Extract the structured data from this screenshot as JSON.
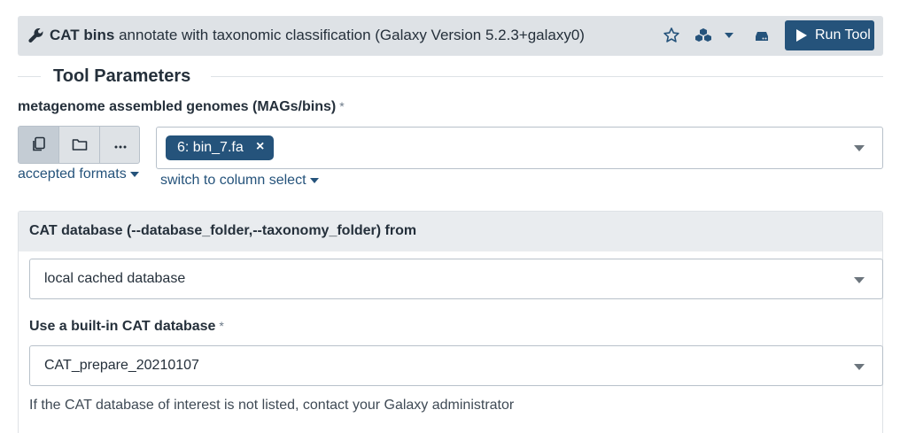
{
  "header": {
    "tool_name": "CAT bins",
    "description": "annotate with taxonomic classification (Galaxy Version 5.2.3+galaxy0)",
    "icons": [
      "wrench-icon",
      "star-icon",
      "cubes-icon",
      "caret-down-icon",
      "hdd-icon"
    ],
    "run_label": "Run Tool"
  },
  "section": {
    "title": "Tool Parameters"
  },
  "input_mags": {
    "label": "metagenome assembled genomes (MAGs/bins)",
    "required_mark": "*",
    "source_buttons": [
      "copy-icon",
      "folder-icon",
      "ellipsis-icon"
    ],
    "selected_chip": "6: bin_7.fa",
    "chip_remove": "×",
    "accepted_formats_label": "accepted formats",
    "switch_label": "switch to column select"
  },
  "db_panel": {
    "title": "CAT database (--database_folder,--taxonomy_folder) from",
    "source_value": "local cached database",
    "builtin_label": "Use a built-in CAT database",
    "required_mark": "*",
    "builtin_value": "CAT_prepare_20210107",
    "help_text": "If the CAT database of interest is not listed, contact your Galaxy administrator"
  },
  "colors": {
    "primary": "#25537b",
    "header_bg": "#dee2e6",
    "panel_head_bg": "#e9ecef"
  }
}
